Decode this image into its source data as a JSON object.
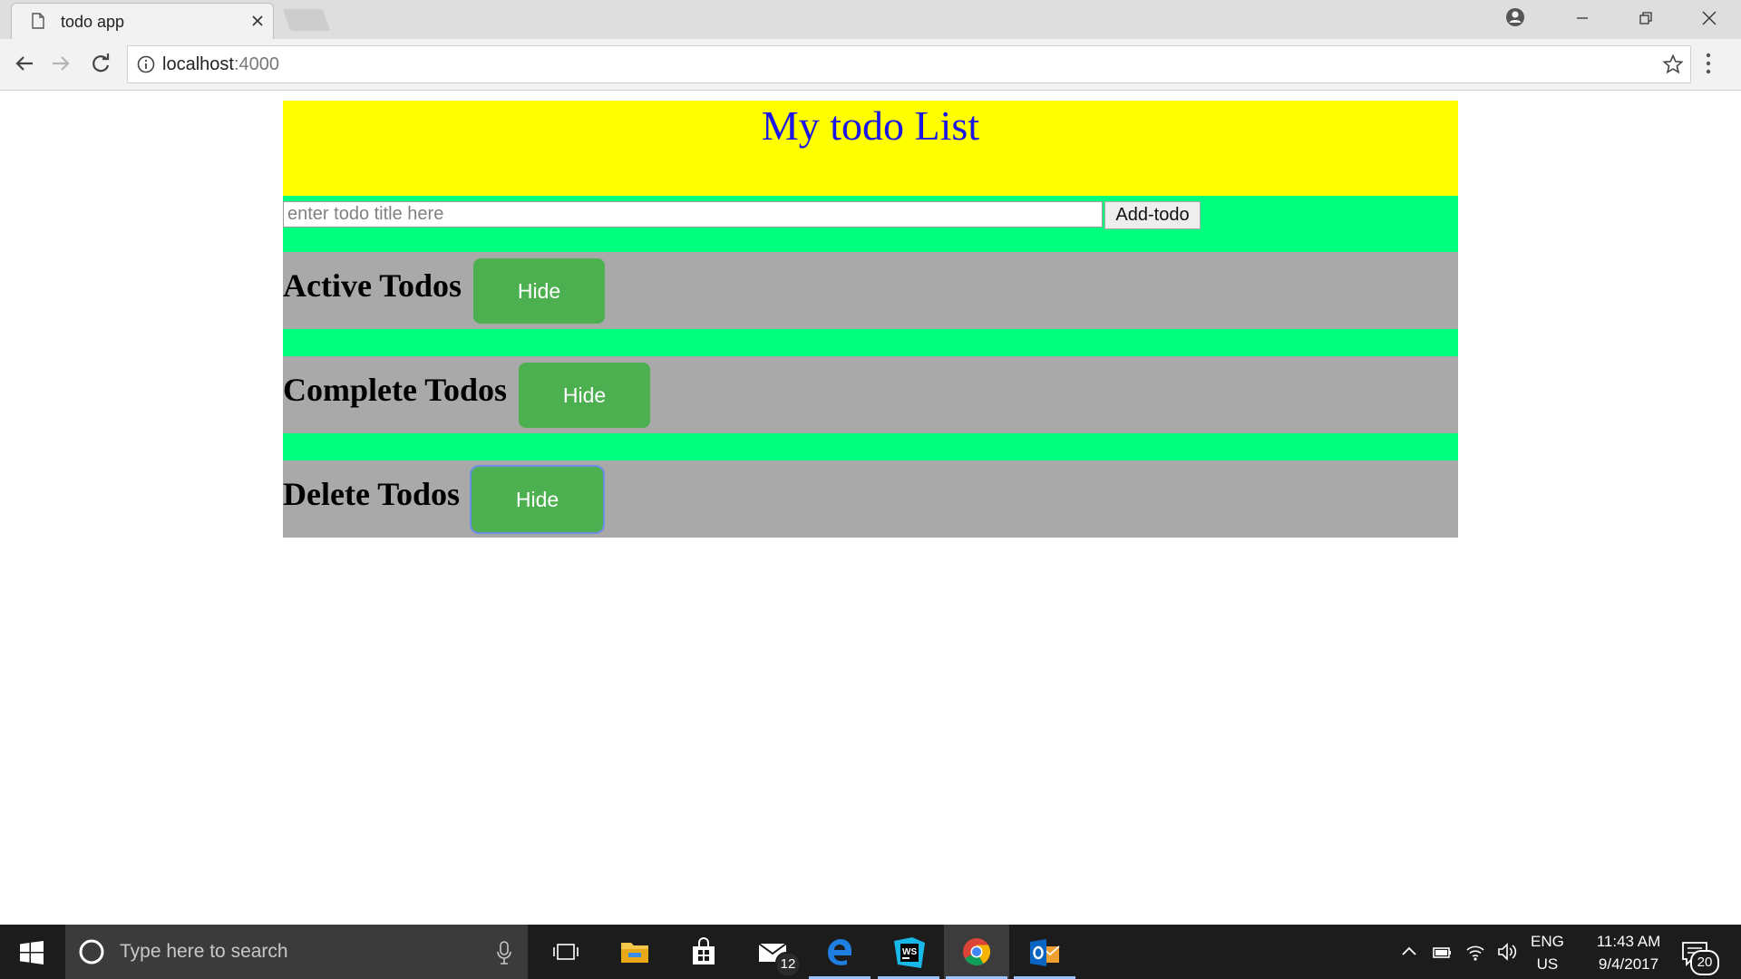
{
  "browser": {
    "tab_title": "todo app",
    "url_host": "localhost",
    "url_port": ":4000"
  },
  "page": {
    "title": "My todo List",
    "input_placeholder": "enter todo title here",
    "add_button_label": "Add-todo",
    "sections": [
      {
        "title": "Active Todos",
        "button_label": "Hide"
      },
      {
        "title": "Complete Todos",
        "button_label": "Hide"
      },
      {
        "title": "Delete Todos",
        "button_label": "Hide"
      }
    ],
    "colors": {
      "header_bg": "#ffff00",
      "title_color": "#1a16e6",
      "separator_bg": "#00ff7f",
      "section_bg": "#a9a9a9",
      "button_bg": "#4caf50"
    }
  },
  "taskbar": {
    "search_placeholder": "Type here to search",
    "mail_badge": "12",
    "language_line1": "ENG",
    "language_line2": "US",
    "time": "11:43 AM",
    "date": "9/4/2017",
    "notification_count": "20"
  }
}
